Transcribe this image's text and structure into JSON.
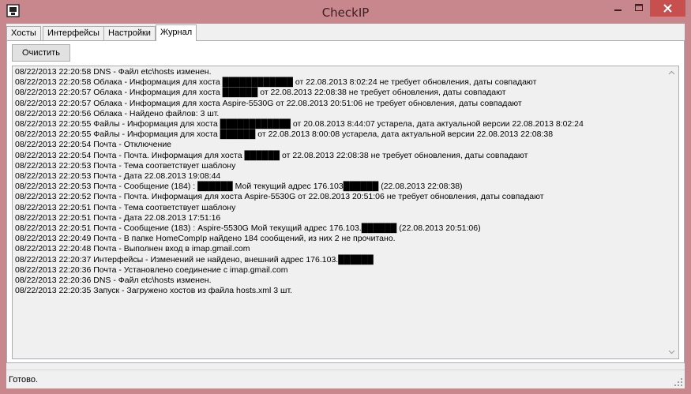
{
  "window": {
    "title": "CheckIP",
    "icons": {
      "app": "app-icon",
      "minimize": "minimize-icon",
      "maximize": "maximize-icon",
      "close": "close-icon"
    }
  },
  "tabs": [
    {
      "label": "Хосты"
    },
    {
      "label": "Интерфейсы"
    },
    {
      "label": "Настройки"
    },
    {
      "label": "Журнал",
      "active": true
    }
  ],
  "journal": {
    "clear_label": "Очистить",
    "lines": [
      "08/22/2013 22:20:58 DNS - Файл etc\\hosts изменен.",
      "08/22/2013 22:20:58 Облака - Информация для хоста ████████████ от 22.08.2013 8:02:24 не требует обновления, даты совпадают",
      "08/22/2013 22:20:57 Облака - Информация для хоста ██████ от 22.08.2013 22:08:38 не требует обновления, даты совпадают",
      "08/22/2013 22:20:57 Облака - Информация для хоста Aspire-5530G от 22.08.2013 20:51:06 не требует обновления, даты совпадают",
      "08/22/2013 22:20:56 Облака - Найдено файлов: 3 шт.",
      "08/22/2013 22:20:55 Файлы - Информация для хоста ████████████ от 20.08.2013 8:44:07 устарела, дата актуальной версии 22.08.2013 8:02:24",
      "08/22/2013 22:20:55 Файлы - Информация для хоста ██████ от 22.08.2013 8:00:08 устарела, дата актуальной версии 22.08.2013 22:08:38",
      "08/22/2013 22:20:54 Почта - Отключение",
      "08/22/2013 22:20:54 Почта - Почта. Информация для хоста ██████ от 22.08.2013 22:08:38 не требует обновления, даты совпадают",
      "08/22/2013 22:20:53 Почта - Тема соответствует шаблону",
      "08/22/2013 22:20:53 Почта - Дата 22.08.2013 19:08:44",
      "08/22/2013 22:20:53 Почта - Сообщение (184) : ██████ Мой текущий адрес 176.103██████ (22.08.2013 22:08:38)",
      "08/22/2013 22:20:52 Почта - Почта. Информация для хоста Aspire-5530G от 22.08.2013 20:51:06 не требует обновления, даты совпадают",
      "08/22/2013 22:20:51 Почта - Тема соответствует шаблону",
      "08/22/2013 22:20:51 Почта - Дата 22.08.2013 17:51:16",
      "08/22/2013 22:20:51 Почта - Сообщение (183) : Aspire-5530G Мой текущий адрес 176.103.██████ (22.08.2013 20:51:06)",
      "08/22/2013 22:20:49 Почта - В папке HomeCompIp найдено 184 сообщений, из них 2 не прочитано.",
      "08/22/2013 22:20:48 Почта - Выполнен вход в imap.gmail.com",
      "08/22/2013 22:20:37 Интерфейсы - Изменений не найдено, внешний адрес 176.103.██████",
      "08/22/2013 22:20:36 Почта - Установлено соединение с imap.gmail.com",
      "08/22/2013 22:20:36 DNS - Файл etc\\hosts изменен.",
      "08/22/2013 22:20:35 Запуск - Загружено хостов из файла hosts.xml 3 шт."
    ]
  },
  "status": {
    "text": "Готово."
  }
}
